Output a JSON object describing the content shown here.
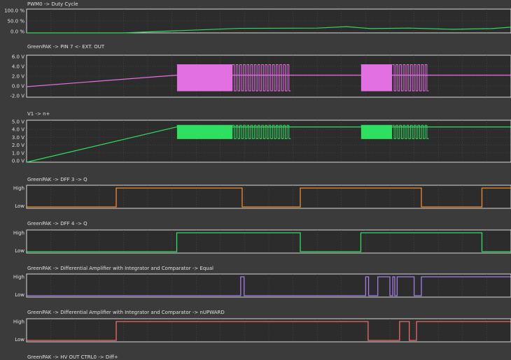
{
  "panels": [
    {
      "id": "pwm-duty",
      "title": "PWM0 -> Duty Cycle",
      "kind": "analog",
      "yticks": [
        "100.0 %",
        "50.0 %",
        "0.0 %"
      ],
      "ymin": 0,
      "ymax": 100,
      "color": "#33d65a",
      "trace": [
        [
          0,
          0
        ],
        [
          20,
          0
        ],
        [
          35,
          12
        ],
        [
          44,
          19
        ],
        [
          60,
          20
        ],
        [
          66,
          26
        ],
        [
          71,
          18
        ],
        [
          79,
          20
        ],
        [
          88,
          15
        ],
        [
          96,
          18
        ],
        [
          100,
          24
        ]
      ]
    },
    {
      "id": "pin7",
      "title": "GreenPAK -> PIN 7 <- EXT. OUT",
      "kind": "analog",
      "yticks": [
        "6.0 V",
        "4.0 V",
        "2.0 V",
        "0.0 V",
        "-2.0 V"
      ],
      "ymin": -2,
      "ymax": 6,
      "color": "#e270e2",
      "trace": [
        [
          0,
          0
        ],
        [
          31,
          2.2
        ],
        [
          100,
          2.2
        ]
      ],
      "bursts": [
        {
          "x0": 31,
          "x1": 42.5,
          "lo": -0.8,
          "hi": 4.2,
          "dense": true
        },
        {
          "x0": 42.5,
          "x1": 54.5,
          "lo": -0.8,
          "hi": 4.2,
          "dense": false
        },
        {
          "x0": 69,
          "x1": 75.5,
          "lo": -0.8,
          "hi": 4.2,
          "dense": true
        },
        {
          "x0": 75.5,
          "x1": 83,
          "lo": -0.8,
          "hi": 4.2,
          "dense": false
        }
      ]
    },
    {
      "id": "v1",
      "title": "V1 -> n+",
      "kind": "analog",
      "yticks": [
        "5.0 V",
        "4.0 V",
        "3.0 V",
        "2.0 V",
        "1.0 V",
        "0.0 V"
      ],
      "ymin": 0,
      "ymax": 5,
      "color": "#2ee060",
      "trace": [
        [
          0,
          0
        ],
        [
          31,
          4.2
        ],
        [
          100,
          4.2
        ]
      ],
      "bursts": [
        {
          "x0": 31,
          "x1": 42.5,
          "lo": 2.8,
          "hi": 4.4,
          "dense": true
        },
        {
          "x0": 42.5,
          "x1": 54.5,
          "lo": 2.8,
          "hi": 4.4,
          "dense": false
        },
        {
          "x0": 69,
          "x1": 75.5,
          "lo": 2.8,
          "hi": 4.4,
          "dense": true
        },
        {
          "x0": 75.5,
          "x1": 83,
          "lo": 2.8,
          "hi": 4.4,
          "dense": false
        }
      ]
    },
    {
      "id": "dff3",
      "title": "GreenPAK -> DFF 3 -> Q",
      "kind": "digital",
      "yticks": [
        "High",
        "Low"
      ],
      "color": "#f08a30",
      "edges": [
        0,
        18.5,
        44.5,
        56.5,
        81.5,
        94,
        100
      ],
      "start": 0
    },
    {
      "id": "dff4",
      "title": "GreenPAK -> DFF 4 -> Q",
      "kind": "digital",
      "yticks": [
        "High",
        "Low"
      ],
      "color": "#2ee060",
      "edges": [
        0,
        31,
        56.5,
        69,
        94,
        100
      ],
      "start": 0
    },
    {
      "id": "equal",
      "title": "GreenPAK -> Differential Amplifier with Integrator and Comparator -> Equal",
      "kind": "digital",
      "yticks": [
        "High",
        "Low"
      ],
      "color": "#a67be8",
      "edges": [
        0,
        44.2,
        44.9,
        70,
        70.6,
        72.5,
        75,
        75.6,
        76,
        76.5,
        80,
        81.5,
        100
      ],
      "start": 0
    },
    {
      "id": "nupward",
      "title": "GreenPAK -> Differential Amplifier with Integrator and Comparator -> nUPWARD",
      "kind": "digital",
      "yticks": [
        "High",
        "Low"
      ],
      "color": "#f06a6a",
      "edges": [
        0,
        18.5,
        70.5,
        77,
        79,
        80.5,
        100
      ],
      "start": 0
    },
    {
      "id": "hv-out",
      "title": "GreenPAK -> HV OUT CTRL0 -> Diff+",
      "kind": "partial",
      "yticks": [],
      "color": "#e0e0e0"
    }
  ]
}
